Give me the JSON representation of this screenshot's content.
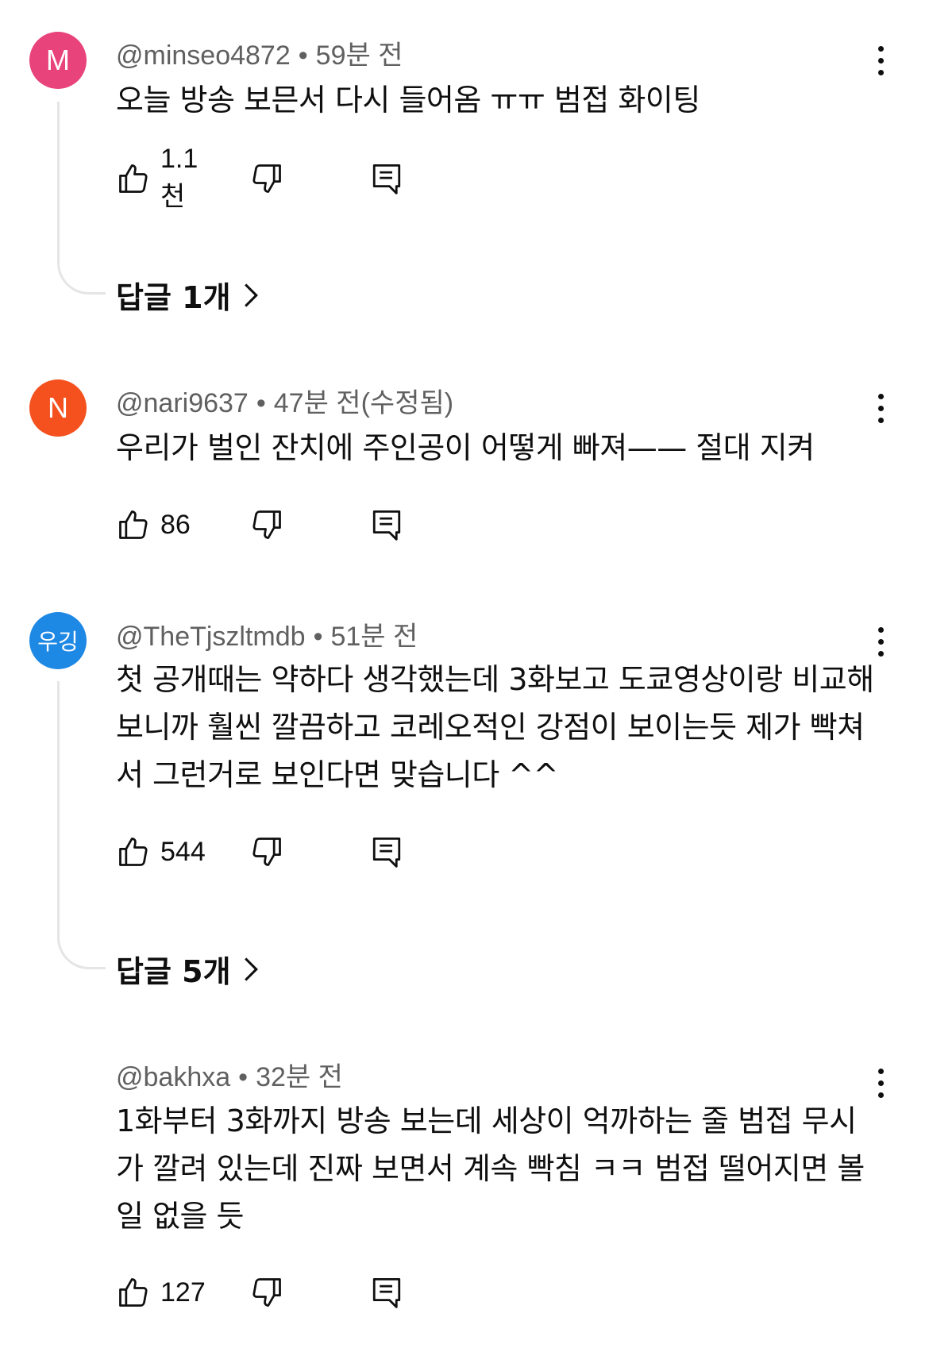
{
  "comments": [
    {
      "avatar_letter": "M",
      "avatar_color": "#e8437a",
      "author": "@minseo4872",
      "time": "59분 전",
      "text": "오늘 방송 보믄서 다시 들어옴 ㅠㅠ 범접 화이팅",
      "likes": "1.1천",
      "replies": "답글 1개"
    },
    {
      "avatar_letter": "N",
      "avatar_color": "#f4511e",
      "author": "@nari9637",
      "time": "47분 전(수정됨)",
      "text": "우리가 벌인 잔치에 주인공이 어떻게 빠져—— 절대 지켜",
      "likes": "86"
    },
    {
      "avatar_letter": "우깅",
      "avatar_color": "#1e88e5",
      "author": "@TheTjszltmdb",
      "time": "51분 전",
      "text": "첫 공개때는 약하다 생각했는데 3화보고 도쿄영상이랑 비교해보니까 훨씬 깔끔하고 코레오적인 강점이 보이는듯 제가 빡쳐서 그런거로 보인다면 맞습니다 ^^",
      "likes": "544",
      "replies": "답글 5개"
    },
    {
      "author": "@bakhxa",
      "time": "32분 전",
      "text": "1화부터 3화까지 방송 보는데 세상이 억까하는 줄 범접 무시가 깔려 있는데 진짜 보면서 계속 빡침 ㅋㅋ 범접 떨어지면 볼일 없을 듯",
      "likes": "127"
    }
  ],
  "icons": {
    "like": "thumbs-up-icon",
    "dislike": "thumbs-down-icon",
    "reply": "reply-comment-icon",
    "more": "more-vert-icon",
    "chevron": "chevron-right-icon"
  }
}
